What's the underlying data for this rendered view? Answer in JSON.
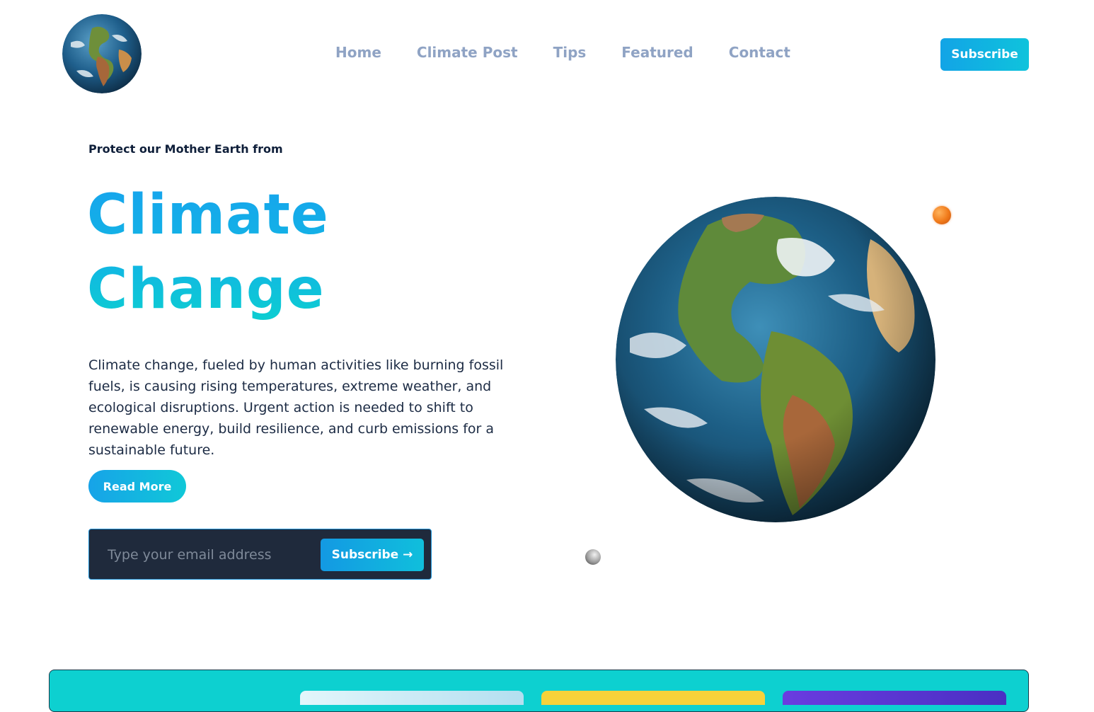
{
  "nav": {
    "items": [
      "Home",
      "Climate Post",
      "Tips",
      "Featured",
      "Contact"
    ],
    "subscribe_label": "Subscribe"
  },
  "hero": {
    "kicker": "Protect our Mother Earth from",
    "headline_line1": "Climate",
    "headline_line2": "Change",
    "description": "Climate change, fueled by human activities like burning fossil fuels, is causing rising temperatures, extreme weather, and ecological disruptions. Urgent action is needed to shift to renewable energy, build resilience, and curb emissions for a sustainable future.",
    "read_more_label": "Read More",
    "email_placeholder": "Type your email address",
    "email_subscribe_label": "Subscribe →"
  },
  "colors": {
    "accent": "#12a4e6",
    "accent_teal": "#0fc3dc",
    "nav_text": "#8fa3c4",
    "band": "#0dd0d0"
  },
  "icons": {
    "logo": "earth-globe-icon",
    "arrow": "arrow-right-icon"
  }
}
